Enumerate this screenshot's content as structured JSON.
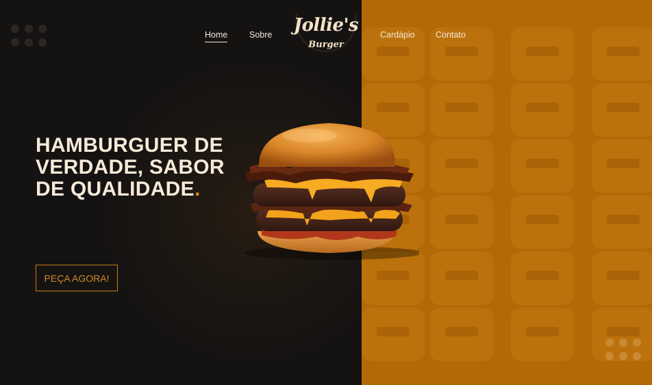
{
  "brand": {
    "logo_main": "Jollie's",
    "logo_sub": "Burger",
    "colors": {
      "dark_bg": "#151312",
      "accent_orange": "#b26907",
      "cream_text": "#f7ead9",
      "cta_orange": "#c97d16"
    }
  },
  "nav": {
    "home": "Home",
    "sobre": "Sobre",
    "cardapio": "Cardápio",
    "contato": "Contato",
    "active": "home"
  },
  "hero": {
    "headline_line1": "HAMBURGUER DE",
    "headline_line2": "VERDADE, SABOR",
    "headline_line3": "DE QUALIDADE",
    "headline_dot": ".",
    "cta_label": "PEÇA AGORA!"
  },
  "icons": {
    "dots_top_left": "dot-grid-icon",
    "dots_bottom_right": "dot-grid-icon",
    "burger": "burger-image"
  }
}
